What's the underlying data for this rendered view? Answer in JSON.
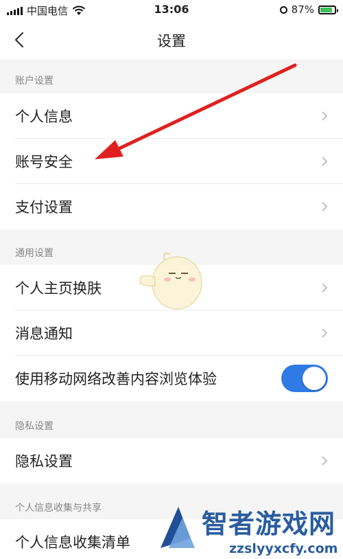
{
  "status_bar": {
    "carrier": "中国电信",
    "time": "13:06",
    "battery_percent": "87%",
    "battery_level": 0.87,
    "icons": [
      "signal-icon",
      "wifi-icon",
      "orientation-lock-icon",
      "battery-charging-icon"
    ]
  },
  "nav": {
    "title": "设置",
    "back_icon": "chevron-left-icon"
  },
  "sections": [
    {
      "header": "账户设置",
      "items": [
        "个人信息",
        "账号安全",
        "支付设置"
      ]
    },
    {
      "header": "通用设置",
      "items": [
        "个人主页换肤",
        "消息通知",
        "使用移动网络改善内容浏览体验"
      ]
    },
    {
      "header": "隐私设置",
      "items": [
        "隐私设置"
      ]
    },
    {
      "header": "个人信息收集与共享",
      "items": [
        "个人信息收集清单"
      ]
    }
  ],
  "toggle": {
    "state": "on",
    "color": "#2f7ae5"
  },
  "annotation": {
    "color": "#e02020",
    "points_to": "账号安全"
  },
  "watermark": {
    "brand": "智者游戏网",
    "domain": "zzslyyxcfy.com"
  },
  "colors": {
    "background": "#f5f5f5",
    "row_background": "#ffffff",
    "section_text": "#888888",
    "primary_text": "#222222",
    "accent": "#2f7ae5"
  }
}
